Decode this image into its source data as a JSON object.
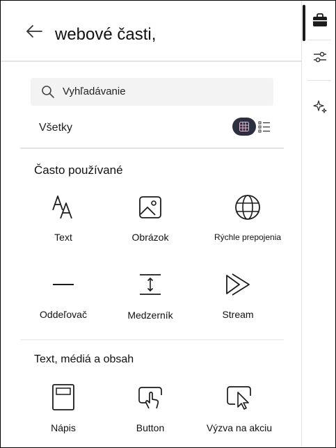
{
  "header": {
    "title": "webové časti,"
  },
  "search": {
    "placeholder": "Vyhľadávanie"
  },
  "filter": {
    "label": "Všetky"
  },
  "sections": [
    {
      "title": "Často používané",
      "items": [
        {
          "label": "Text",
          "icon": "text-icon"
        },
        {
          "label": "Obrázok",
          "icon": "image-icon"
        },
        {
          "label": "Rýchle prepojenia",
          "icon": "globe-icon"
        },
        {
          "label": "Oddeľovač",
          "icon": "divider-icon"
        },
        {
          "label": "Medzerník",
          "icon": "spacer-icon"
        },
        {
          "label": "Stream",
          "icon": "stream-icon"
        }
      ]
    },
    {
      "title": "Text, médiá a obsah",
      "items": [
        {
          "label": "Nápis",
          "icon": "banner-icon"
        },
        {
          "label": "Button",
          "icon": "button-icon"
        },
        {
          "label": "Výzva na akciu",
          "icon": "call-to-action-icon"
        }
      ]
    }
  ],
  "rail": {
    "items": [
      {
        "icon": "toolbox-icon",
        "active": true
      },
      {
        "icon": "settings-sliders-icon",
        "active": false
      },
      {
        "icon": "sparkle-icon",
        "active": false
      }
    ]
  }
}
